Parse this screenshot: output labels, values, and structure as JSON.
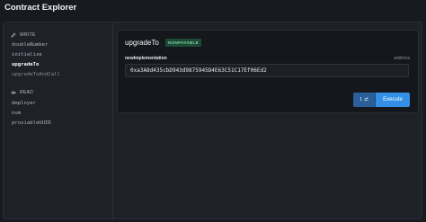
{
  "app": {
    "title": "Contract Explorer"
  },
  "sidebar": {
    "write": {
      "heading": "WRITE",
      "icon": "pencil-icon",
      "items": [
        "doubleNumber",
        "initialize",
        "upgradeTo",
        "upgradeToAndCall"
      ],
      "active": "upgradeTo"
    },
    "read": {
      "heading": "READ",
      "icon": "eye-icon",
      "items": [
        "deployer",
        "num",
        "proxiableUUID"
      ]
    }
  },
  "function": {
    "name": "upgradeTo",
    "badge": "NONPAYABLE",
    "param": {
      "label": "newImplementation",
      "type": "address",
      "value": "0xa3A8d435cbD943d9875945D4E63C51C17Ef06Ed2"
    },
    "count_label": "1",
    "count_icon": "swap-icon",
    "count_symbol": "⇄",
    "execute_label": "Execute"
  },
  "colors": {
    "accent": "#3390e6",
    "badge_bg": "#1e4a35",
    "badge_text": "#79d3a4"
  }
}
